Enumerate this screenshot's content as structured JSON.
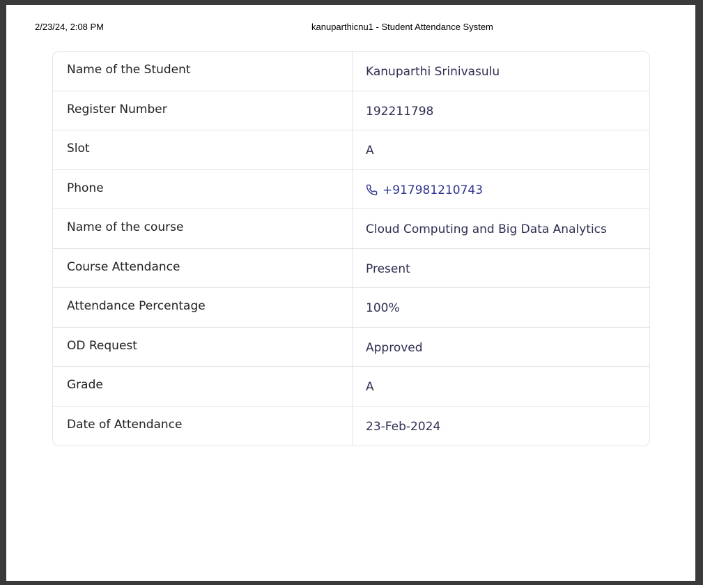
{
  "print_header": {
    "datetime": "2/23/24, 2:08 PM",
    "title": "kanuparthicnu1 - Student Attendance System"
  },
  "record": {
    "student_name_label": "Name of the Student",
    "student_name": "Kanuparthi Srinivasulu",
    "register_number_label": "Register Number",
    "register_number": "192211798",
    "slot_label": "Slot",
    "slot": "A",
    "phone_label": "Phone",
    "phone_icon": "phone-icon",
    "phone": "+917981210743",
    "course_label": "Name of the course",
    "course": "Cloud Computing and Big Data Analytics",
    "attendance_label": "Course Attendance",
    "attendance": "Present",
    "percentage_label": "Attendance Percentage",
    "percentage": "100%",
    "od_label": "OD Request",
    "od": "Approved",
    "grade_label": "Grade",
    "grade": "A",
    "date_label": "Date of Attendance",
    "date": "23-Feb-2024"
  },
  "colors": {
    "label_text": "#222222",
    "value_text": "#2e2e52",
    "link": "#2f3590",
    "border": "#e4e4e7"
  }
}
